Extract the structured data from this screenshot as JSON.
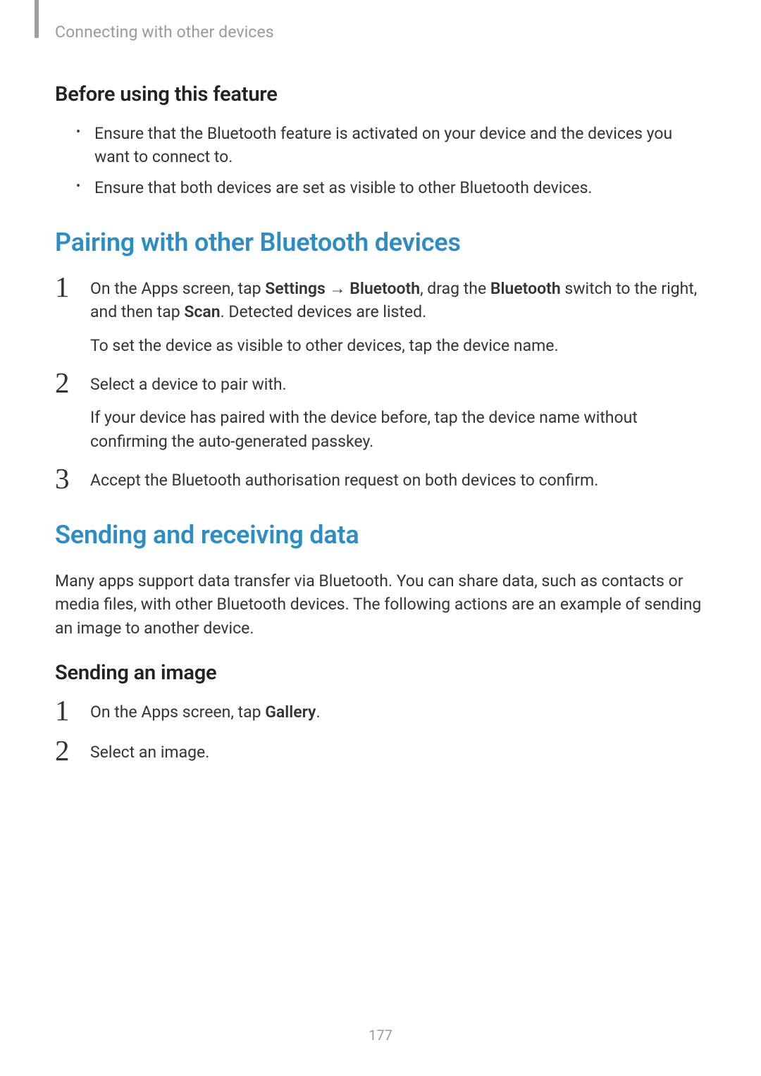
{
  "header": {
    "section": "Connecting with other devices"
  },
  "before": {
    "heading": "Before using this feature",
    "bullets": [
      "Ensure that the Bluetooth feature is activated on your device and the devices you want to connect to.",
      "Ensure that both devices are set as visible to other Bluetooth devices."
    ]
  },
  "pairing": {
    "heading": "Pairing with other Bluetooth devices",
    "step1": {
      "num": "1",
      "pre": "On the Apps screen, tap ",
      "b1": "Settings",
      "arrow": " → ",
      "b2": "Bluetooth",
      "mid": ", drag the ",
      "b3": "Bluetooth",
      "post1": " switch to the right, and then tap ",
      "b4": "Scan",
      "post2": ". Detected devices are listed.",
      "line2": "To set the device as visible to other devices, tap the device name."
    },
    "step2": {
      "num": "2",
      "line1": "Select a device to pair with.",
      "line2": "If your device has paired with the device before, tap the device name without confirming the auto-generated passkey."
    },
    "step3": {
      "num": "3",
      "line1": "Accept the Bluetooth authorisation request on both devices to confirm."
    }
  },
  "sending": {
    "heading": "Sending and receiving data",
    "intro": "Many apps support data transfer via Bluetooth. You can share data, such as contacts or media files, with other Bluetooth devices. The following actions are an example of sending an image to another device.",
    "subheading": "Sending an image",
    "step1": {
      "num": "1",
      "pre": "On the Apps screen, tap ",
      "b1": "Gallery",
      "post": "."
    },
    "step2": {
      "num": "2",
      "line1": "Select an image."
    }
  },
  "pageNumber": "177"
}
